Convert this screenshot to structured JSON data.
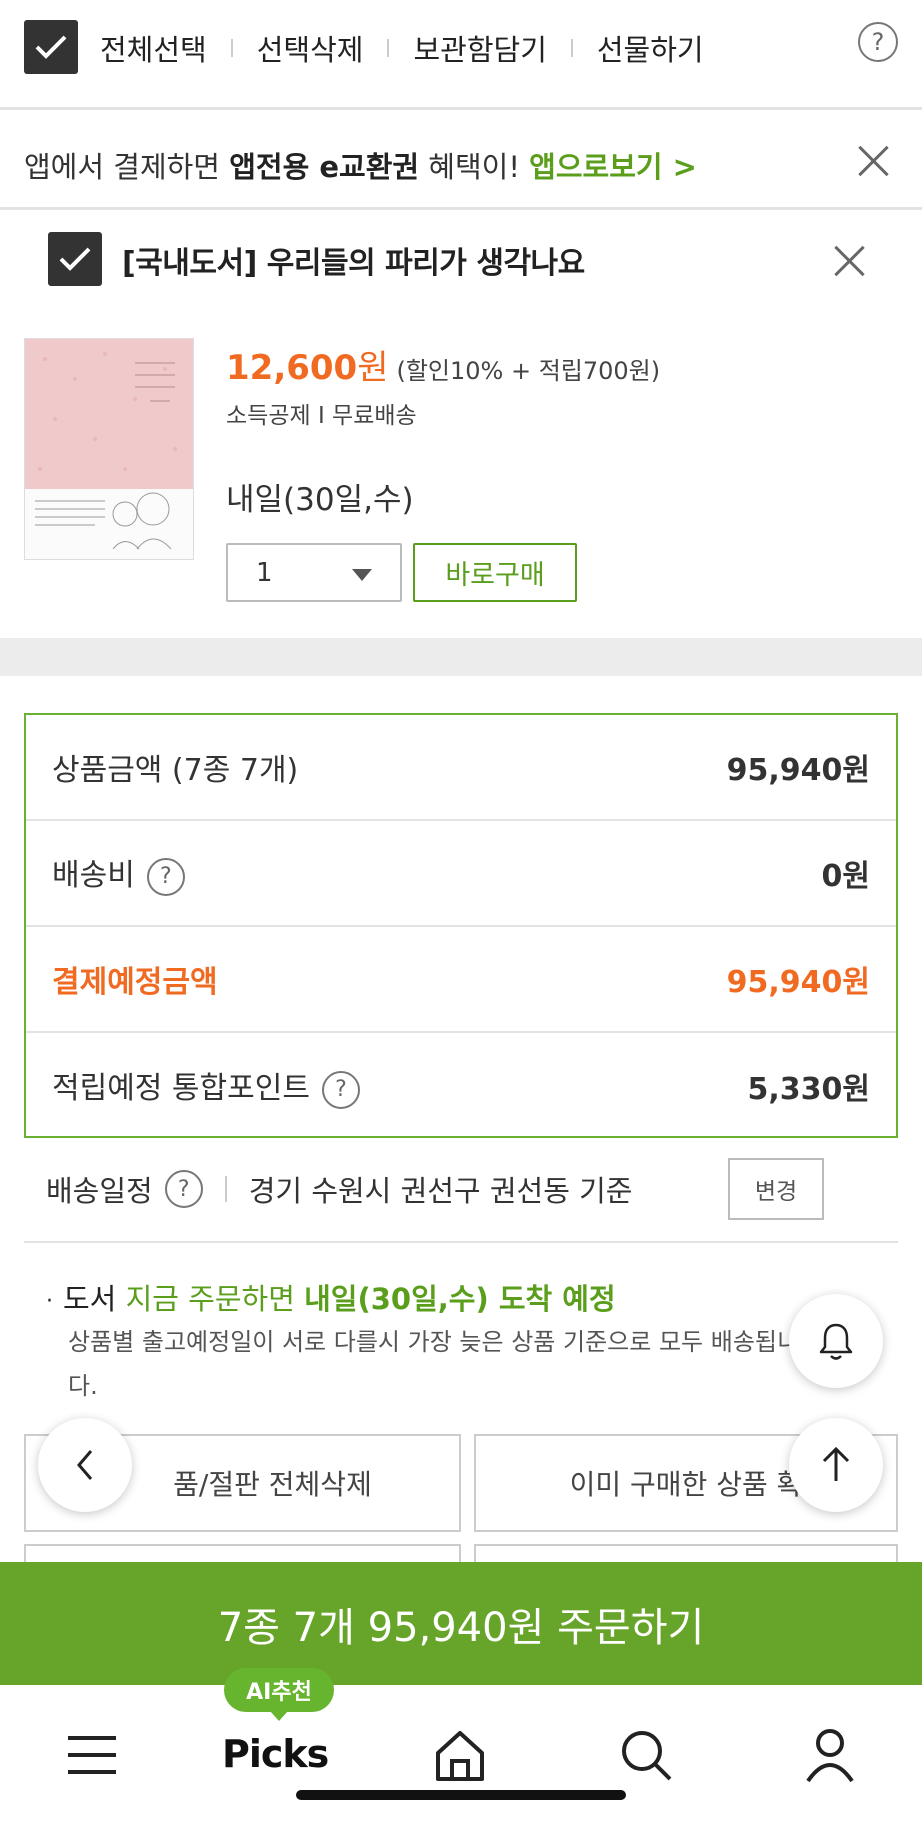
{
  "topbar": {
    "select_all": "전체선택",
    "delete_selected": "선택삭제",
    "add_to_storage": "보관함담기",
    "gift": "선물하기",
    "help": "?"
  },
  "banner": {
    "prefix": "앱에서 결제하면 ",
    "highlight": "앱전용 e교환권",
    "suffix": " 혜택이! ",
    "link": "앱으로보기 >"
  },
  "product": {
    "title": "[국내도서] 우리들의 파리가 생각나요",
    "price": "12,600",
    "price_unit": "원",
    "price_detail": "(할인10% + 적립700원)",
    "tags": "소득공제 I 무료배송",
    "delivery": "내일(30일,수)",
    "quantity": "1",
    "buy_now": "바로구매"
  },
  "summary": {
    "rows": [
      {
        "label": "상품금액 (7종 7개)",
        "value": "95,940원"
      },
      {
        "label": "배송비",
        "value": "0원"
      },
      {
        "label": "결제예정금액",
        "value": "95,940원"
      },
      {
        "label": "적립예정 통합포인트",
        "value": "5,330원"
      }
    ]
  },
  "schedule": {
    "label": "배송일정",
    "address": "경기 수원시 권선구 권선동 기준",
    "change": "변경"
  },
  "arrival": {
    "prefix": "도서 ",
    "green": "지금 주문하면 ",
    "bold": "내일(30일,수) 도착 예정",
    "note": "상품별 출고예정일이 서로 다를시 가장 늦은 상품 기준으로 모두 배송됩니다."
  },
  "actions": {
    "delete_soldout": "품/절판 전체삭제",
    "already_bought": "이미 구매한 상품 확"
  },
  "order": {
    "label": "7종 7개 95,940원 주문하기"
  },
  "nav": {
    "ai_badge": "AI추천",
    "picks": "Picks",
    "icons": [
      "menu-icon",
      "home-icon",
      "search-icon",
      "user-icon"
    ]
  },
  "colors": {
    "green": "#67a52a",
    "orange": "#f06a22"
  }
}
